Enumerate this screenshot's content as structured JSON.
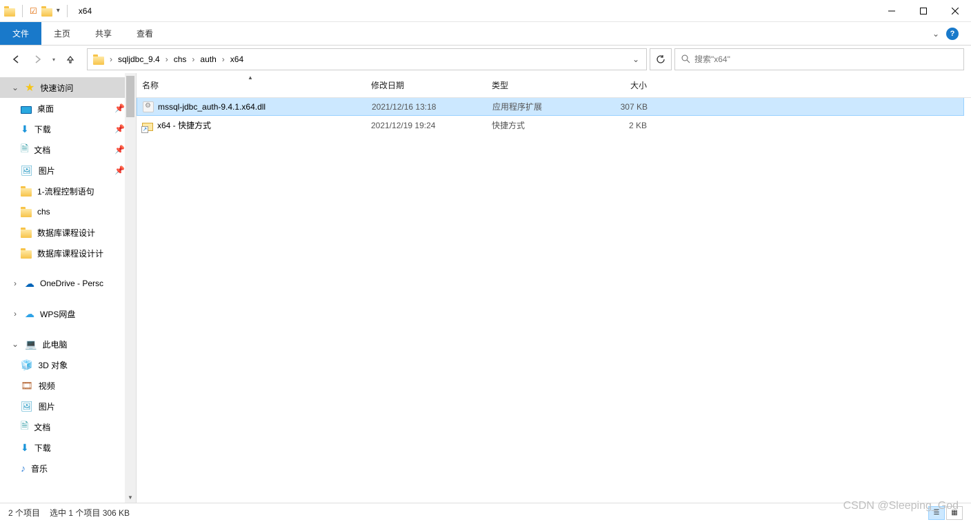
{
  "window": {
    "title": "x64"
  },
  "ribbon": {
    "file": "文件",
    "tabs": [
      "主页",
      "共享",
      "查看"
    ]
  },
  "breadcrumb": {
    "segments": [
      "sqljdbc_9.4",
      "chs",
      "auth",
      "x64"
    ]
  },
  "search": {
    "placeholder": "搜索\"x64\""
  },
  "sidebar": {
    "quick_access": {
      "label": "快速访问"
    },
    "quick_items": [
      {
        "icon": "desktop",
        "label": "桌面",
        "pinned": true
      },
      {
        "icon": "download",
        "label": "下载",
        "pinned": true
      },
      {
        "icon": "documents",
        "label": "文档",
        "pinned": true
      },
      {
        "icon": "pictures",
        "label": "图片",
        "pinned": true
      },
      {
        "icon": "folder",
        "label": "1-流程控制语句",
        "pinned": false
      },
      {
        "icon": "folder",
        "label": "chs",
        "pinned": false
      },
      {
        "icon": "folder",
        "label": "数据库课程设计",
        "pinned": false
      },
      {
        "icon": "folder",
        "label": "数据库课程设计计",
        "pinned": false
      }
    ],
    "clouds": [
      {
        "icon": "onedrive",
        "label": "OneDrive - Persc"
      },
      {
        "icon": "wps",
        "label": "WPS网盘"
      }
    ],
    "this_pc": {
      "label": "此电脑"
    },
    "pc_items": [
      {
        "icon": "3d",
        "label": "3D 对象"
      },
      {
        "icon": "video",
        "label": "视频"
      },
      {
        "icon": "pictures",
        "label": "图片"
      },
      {
        "icon": "documents",
        "label": "文档"
      },
      {
        "icon": "download",
        "label": "下载"
      },
      {
        "icon": "music",
        "label": "音乐"
      }
    ]
  },
  "columns": {
    "name": "名称",
    "date": "修改日期",
    "type": "类型",
    "size": "大小"
  },
  "files": [
    {
      "icon": "dll",
      "name": "mssql-jdbc_auth-9.4.1.x64.dll",
      "date": "2021/12/16 13:18",
      "type": "应用程序扩展",
      "size": "307 KB",
      "selected": true
    },
    {
      "icon": "shortcut",
      "name": "x64 - 快捷方式",
      "date": "2021/12/19 19:24",
      "type": "快捷方式",
      "size": "2 KB",
      "selected": false
    }
  ],
  "status": {
    "count": "2 个项目",
    "selection": "选中 1 个项目  306 KB"
  },
  "watermark": "CSDN @Sleeping_God"
}
